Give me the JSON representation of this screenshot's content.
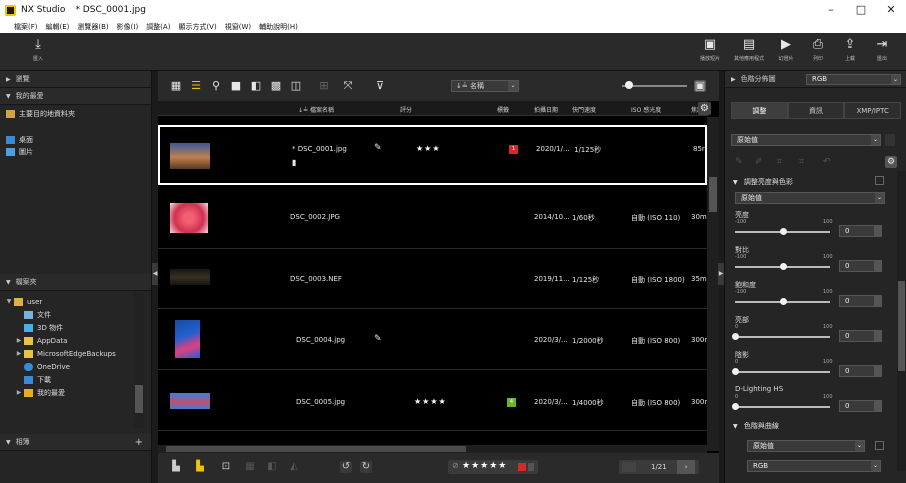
{
  "window": {
    "app_name": "NX Studio",
    "file_title": "* DSC_0001.jpg",
    "controls": [
      "–",
      "□",
      "✕"
    ]
  },
  "menu": [
    "檔案(F)",
    "編輯(E)",
    "瀏覽器(B)",
    "影像(I)",
    "調整(A)",
    "顯示方式(V)",
    "視窗(W)",
    "輔助說明(H)"
  ],
  "toolbar": {
    "import_label": "匯入",
    "buttons": [
      "播放短片",
      "其他應用程式",
      "幻燈片",
      "列印",
      "上載",
      "匯出"
    ]
  },
  "left_panel": {
    "browse_label": "瀏覽",
    "favorites_label": "我的最愛",
    "favorites_items": [
      "主要目的地資料夾",
      "桌面",
      "圖片"
    ],
    "folders_label": "檔案夾",
    "tree": [
      {
        "label": "user",
        "level": 0,
        "arrow": "▼"
      },
      {
        "label": "文件",
        "level": 1,
        "arrow": ""
      },
      {
        "label": "3D 物件",
        "level": 1,
        "arrow": ""
      },
      {
        "label": "AppData",
        "level": 1,
        "arrow": "▶"
      },
      {
        "label": "MicrosoftEdgeBackups",
        "level": 1,
        "arrow": "▶"
      },
      {
        "label": "OneDrive",
        "level": 1,
        "arrow": ""
      },
      {
        "label": "下載",
        "level": 1,
        "arrow": ""
      },
      {
        "label": "我的最愛",
        "level": 1,
        "arrow": "▶"
      }
    ],
    "albums_label": "相簿",
    "albums_add": "+"
  },
  "browser": {
    "sort_label": "↓≟ 名稱",
    "columns": [
      "↓≟ 檔案名稱",
      "評分",
      "標籤",
      "拍攝日期",
      "快門速度",
      "ISO 感光度",
      "焦距"
    ],
    "rows": [
      {
        "file": "* DSC_0001.jpg",
        "edited": true,
        "rating": "★★★",
        "label": "1",
        "label_color": "#d42a2a",
        "date": "2020/1/...",
        "shutter": "1/125秒",
        "iso": "",
        "focal": "85r",
        "selected": true
      },
      {
        "file": "DSC_0002.JPG",
        "edited": false,
        "rating": "",
        "label": "",
        "label_color": "",
        "date": "2014/10...",
        "shutter": "1/60秒",
        "iso": "自動 (ISO 110)",
        "focal": "30m",
        "selected": false
      },
      {
        "file": "DSC_0003.NEF",
        "edited": false,
        "rating": "",
        "label": "",
        "label_color": "",
        "date": "2019/11...",
        "shutter": "1/125秒",
        "iso": "自動 (ISO 1800)",
        "focal": "35m",
        "selected": false
      },
      {
        "file": "DSC_0004.jpg",
        "edited": true,
        "rating": "",
        "label": "",
        "label_color": "",
        "date": "2020/3/...",
        "shutter": "1/2000秒",
        "iso": "自動 (ISO 800)",
        "focal": "300r",
        "selected": false
      },
      {
        "file": "DSC_0005.jpg",
        "edited": false,
        "rating": "★★★★",
        "label": "4",
        "label_color": "#6ab42a",
        "date": "2020/3/...",
        "shutter": "1/4000秒",
        "iso": "自動 (ISO 800)",
        "focal": "300r",
        "selected": false
      }
    ],
    "page_indicator": "1/21",
    "bottom_rating": "★★★★★"
  },
  "right_panel": {
    "histogram_label": "色階分佈圖",
    "histogram_mode": "RGB",
    "tabs": [
      "調整",
      "資訊",
      "XMP/IPTC"
    ],
    "preset": "原始值",
    "section_brightness": "調整亮度與色彩",
    "section_preset": "原始值",
    "sliders": [
      {
        "label": "亮度",
        "min": "-100",
        "max": "100",
        "value": "0",
        "pos": 0.5
      },
      {
        "label": "對比",
        "min": "-100",
        "max": "100",
        "value": "0",
        "pos": 0.5
      },
      {
        "label": "飽和度",
        "min": "-100",
        "max": "100",
        "value": "0",
        "pos": 0.5
      },
      {
        "label": "亮部",
        "min": "0",
        "max": "100",
        "value": "0",
        "pos": 0.0
      },
      {
        "label": "陰影",
        "min": "0",
        "max": "100",
        "value": "0",
        "pos": 0.0
      },
      {
        "label": "D-Lighting HS",
        "min": "0",
        "max": "100",
        "value": "0",
        "pos": 0.0
      }
    ],
    "section_curves": "色階與曲線",
    "curves_preset": "原始值",
    "curves_channel": "RGB"
  }
}
